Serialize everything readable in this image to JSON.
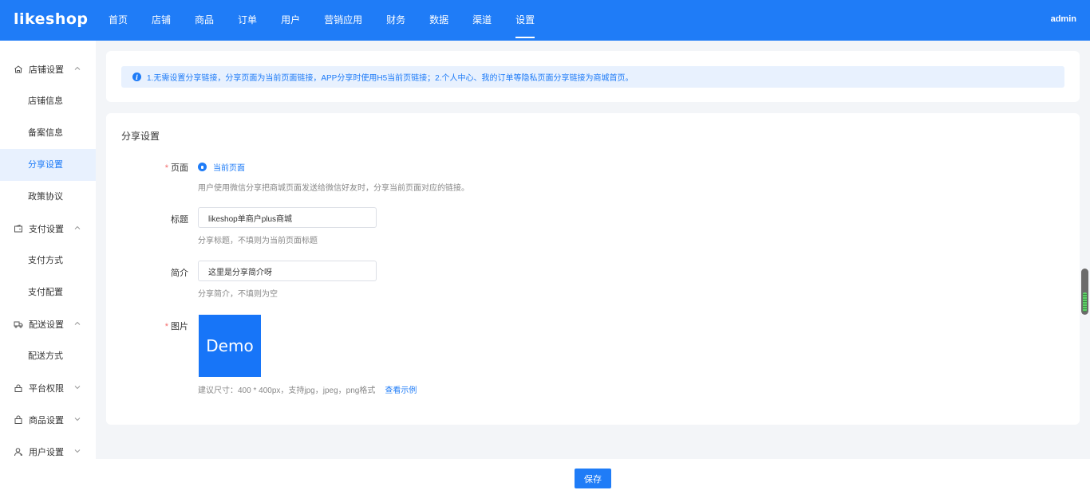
{
  "header": {
    "logo": "likeshop",
    "nav": [
      "首页",
      "店铺",
      "商品",
      "订单",
      "用户",
      "营销应用",
      "财务",
      "数据",
      "渠道",
      "设置"
    ],
    "user": "admin"
  },
  "sidebar": {
    "groups": [
      {
        "label": "店铺设置",
        "icon": "home-icon",
        "expanded": true,
        "items": [
          "店铺信息",
          "备案信息",
          "分享设置",
          "政策协议"
        ]
      },
      {
        "label": "支付设置",
        "icon": "wallet-icon",
        "expanded": true,
        "items": [
          "支付方式",
          "支付配置"
        ]
      },
      {
        "label": "配送设置",
        "icon": "truck-icon",
        "expanded": true,
        "items": [
          "配送方式"
        ]
      },
      {
        "label": "平台权限",
        "icon": "lock-icon",
        "expanded": false,
        "items": []
      },
      {
        "label": "商品设置",
        "icon": "bag-icon",
        "expanded": false,
        "items": []
      },
      {
        "label": "用户设置",
        "icon": "user-icon",
        "expanded": false,
        "items": []
      }
    ],
    "active_item": "分享设置"
  },
  "notice": {
    "text": "1.无需设置分享链接，分享页面为当前页面链接，APP分享时使用H5当前页链接；2.个人中心、我的订单等隐私页面分享链接为商城首页。"
  },
  "form": {
    "title": "分享设置",
    "page": {
      "label": "页面",
      "option": "当前页面",
      "help": "用户使用微信分享把商城页面发送给微信好友时，分享当前页面对应的链接。"
    },
    "share_title": {
      "label": "标题",
      "value": "likeshop单商户plus商城",
      "help": "分享标题，不填则为当前页面标题"
    },
    "intro": {
      "label": "简介",
      "value": "这里是分享简介呀",
      "help": "分享简介，不填则为空"
    },
    "image": {
      "label": "图片",
      "demo_text": "Demo",
      "help": "建议尺寸：400 * 400px，支持jpg，jpeg，png格式",
      "link": "查看示例"
    }
  },
  "footer": {
    "save": "保存"
  }
}
